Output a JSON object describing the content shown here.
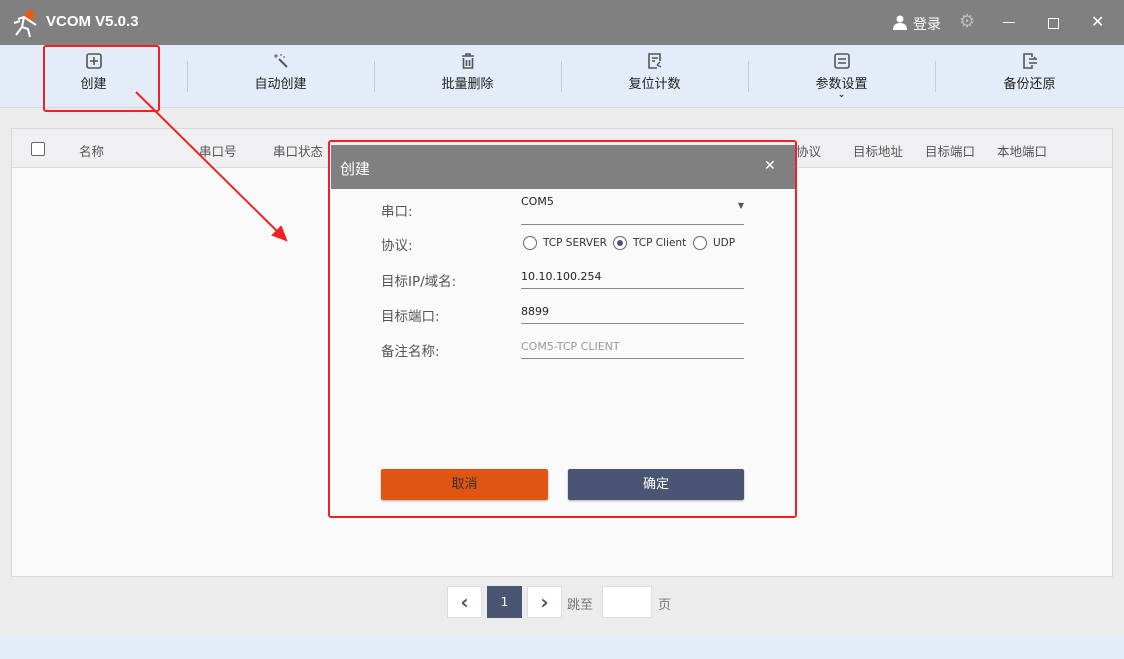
{
  "app": {
    "title": "VCOM V5.0.3",
    "login": "登录"
  },
  "toolbar": [
    {
      "label": "创建",
      "icon": "plus-square-icon"
    },
    {
      "label": "自动创建",
      "icon": "magic-wand-icon"
    },
    {
      "label": "批量删除",
      "icon": "trash-icon"
    },
    {
      "label": "复位计数",
      "icon": "reset-icon"
    },
    {
      "label": "参数设置",
      "icon": "sliders-icon"
    },
    {
      "label": "备份还原",
      "icon": "export-icon"
    }
  ],
  "table": {
    "headers": [
      "名称",
      "串口号",
      "串口状态",
      "协议",
      "目标地址",
      "目标端口",
      "本地端口"
    ]
  },
  "pager": {
    "current": "1",
    "goto": "跳至",
    "page": "页",
    "goto_value": ""
  },
  "dialog": {
    "title": "创建",
    "serial_label": "串口:",
    "serial_value": "COM5",
    "protocol_label": "协议:",
    "protocols": [
      "TCP SERVER",
      "TCP Client",
      "UDP"
    ],
    "protocol_selected": "TCP Client",
    "ip_label": "目标IP/域名:",
    "ip_value": "10.10.100.254",
    "port_label": "目标端口:",
    "port_value": "8899",
    "note_label": "备注名称:",
    "note_placeholder": "COM5-TCP CLIENT",
    "cancel": "取消",
    "ok": "确定"
  },
  "colors": {
    "titlebar": "#808080",
    "toolbar": "#e4ecf9",
    "cancel": "#e05512",
    "ok": "#4a5573",
    "highlight": "#ee2222"
  }
}
